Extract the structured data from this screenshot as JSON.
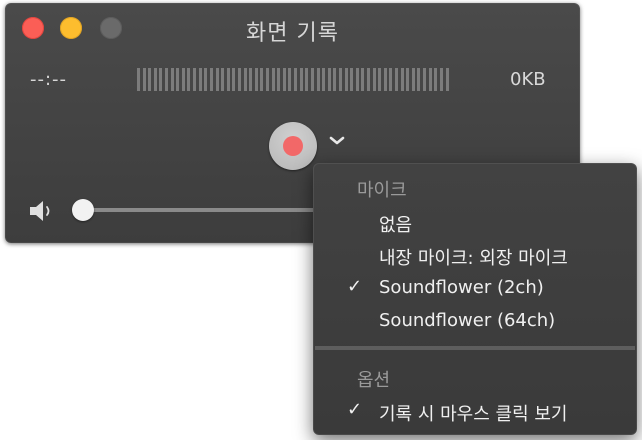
{
  "window": {
    "title": "화면 기록",
    "elapsed_time": "--:--",
    "file_size": "0KB",
    "volume_level": 0.0
  },
  "icons": {
    "close": "close-button",
    "minimize": "minimize-button",
    "zoom": "zoom-button",
    "record": "record-icon",
    "options": "chevron-down-icon",
    "volume": "speaker-icon",
    "check": "checkmark-icon"
  },
  "colors": {
    "close": "#fb5e56",
    "minimize": "#fdbd2e",
    "record": "#f26868"
  },
  "menu": {
    "microphone_header": "마이크",
    "microphone_options": [
      {
        "label": "없음",
        "checked": false
      },
      {
        "label": "내장 마이크: 외장 마이크",
        "checked": false
      },
      {
        "label": "Soundflower (2ch)",
        "checked": true
      },
      {
        "label": "Soundflower (64ch)",
        "checked": false
      }
    ],
    "options_header": "옵션",
    "options_items": [
      {
        "label": "기록 시 마우스 클릭 보기",
        "checked": true
      }
    ],
    "check_glyph": "✓"
  }
}
